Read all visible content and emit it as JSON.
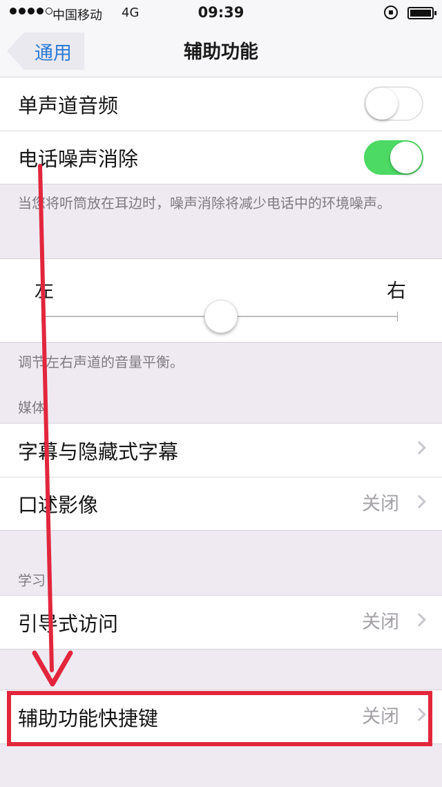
{
  "status_bar": {
    "carrier": "中国移动",
    "network": "4G",
    "time": "09:39"
  },
  "nav": {
    "back_label": "通用",
    "title": "辅助功能"
  },
  "audio_group": {
    "mono_audio": {
      "label": "单声道音频",
      "enabled": false
    },
    "noise_cancel": {
      "label": "电话噪声消除",
      "enabled": true
    }
  },
  "noise_footer": "当您将听筒放在耳边时，噪声消除将减少电话中的环境噪声。",
  "balance": {
    "left_label": "左",
    "right_label": "右",
    "value_percent": 50,
    "footer": "调节左右声道的音量平衡。"
  },
  "media_section": {
    "header": "媒体",
    "items": [
      {
        "label": "字幕与隐藏式字幕",
        "value": ""
      },
      {
        "label": "口述影像",
        "value": "关闭"
      }
    ]
  },
  "learning_section": {
    "header": "学习",
    "items": [
      {
        "label": "引导式访问",
        "value": "关闭"
      }
    ]
  },
  "shortcut": {
    "label": "辅助功能快捷键",
    "value": "关闭"
  },
  "colors": {
    "accent": "#2b7ad6",
    "toggle_on": "#4cd964",
    "annotation": "#e2263c"
  }
}
